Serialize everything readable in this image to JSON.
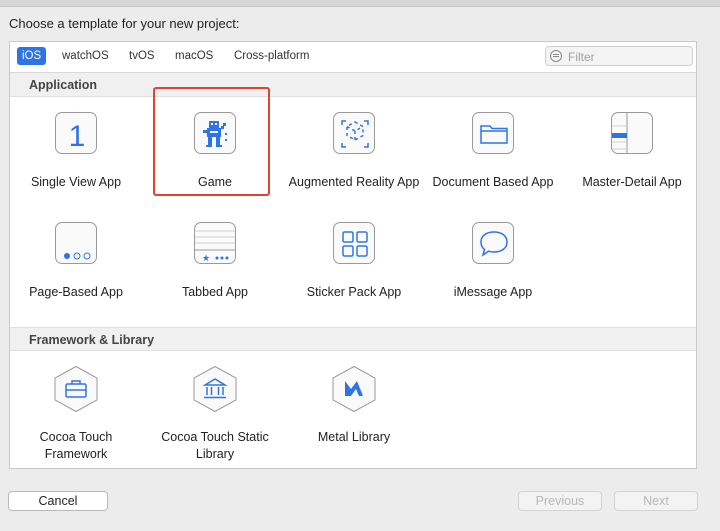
{
  "prompt": "Choose a template for your new project:",
  "tabs": [
    {
      "label": "iOS"
    },
    {
      "label": "watchOS"
    },
    {
      "label": "tvOS"
    },
    {
      "label": "macOS"
    },
    {
      "label": "Cross-platform"
    }
  ],
  "active_tab": "iOS",
  "filter": {
    "placeholder": "Filter",
    "value": ""
  },
  "sections": {
    "application": {
      "title": "Application",
      "items": [
        {
          "label": "Single View App",
          "icon": "single-view-icon"
        },
        {
          "label": "Game",
          "icon": "game-icon"
        },
        {
          "label": "Augmented Reality App",
          "icon": "ar-cube-icon"
        },
        {
          "label": "Document Based App",
          "icon": "folder-icon"
        },
        {
          "label": "Master-Detail App",
          "icon": "master-detail-icon"
        },
        {
          "label": "Page-Based App",
          "icon": "page-dots-icon"
        },
        {
          "label": "Tabbed App",
          "icon": "tab-bar-icon"
        },
        {
          "label": "Sticker Pack App",
          "icon": "sticker-grid-icon"
        },
        {
          "label": "iMessage App",
          "icon": "message-bubble-icon"
        }
      ]
    },
    "framework": {
      "title": "Framework & Library",
      "items": [
        {
          "label": "Cocoa Touch Framework",
          "icon": "toolbox-icon"
        },
        {
          "label": "Cocoa Touch Static Library",
          "icon": "bank-icon"
        },
        {
          "label": "Metal Library",
          "icon": "metal-icon"
        }
      ]
    }
  },
  "selected_template": "Game",
  "buttons": {
    "cancel": "Cancel",
    "previous": "Previous",
    "next": "Next"
  },
  "colors": {
    "accent": "#2f74e6",
    "selection": "#e1432c"
  }
}
